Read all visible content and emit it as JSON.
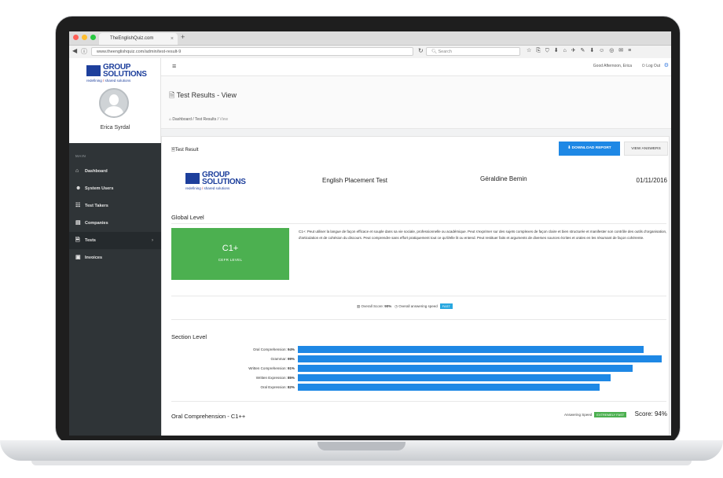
{
  "browser": {
    "tab_title": "TheEnglishQuiz.com",
    "url": "www.theenglishquiz.com/admin/test-result-9",
    "search_placeholder": "Search",
    "dot_colors": [
      "#ff5f57",
      "#ffbd2e",
      "#28c940"
    ]
  },
  "brand": {
    "name_line1": "GROUP",
    "name_line2": "SOLUTIONS",
    "tag_a": "redefining",
    "tag_sep": " / ",
    "tag_b": "shared solutions",
    "color": "#1d3f9c"
  },
  "sidebar": {
    "user_name": "Erica Syrdal",
    "menu_label": "MAIN",
    "items": [
      {
        "label": "Dashboard",
        "icon": "home-icon"
      },
      {
        "label": "System Users",
        "icon": "users-icon"
      },
      {
        "label": "Test Takers",
        "icon": "group-icon"
      },
      {
        "label": "Companies",
        "icon": "building-icon"
      },
      {
        "label": "Tests",
        "icon": "file-icon"
      },
      {
        "label": "Invoices",
        "icon": "invoice-icon"
      }
    ],
    "active_index": 4
  },
  "topbar": {
    "greeting": "Good Afternoon, Erica",
    "logout": "Log Out"
  },
  "page": {
    "title": "Test Results - View",
    "breadcrumb": [
      "Dashboard",
      "Test Results",
      "View"
    ]
  },
  "report": {
    "panel_title": "Test Result",
    "download_button": "DOWNLOAD REPORT",
    "view_answers_button": "VIEW ANSWERS",
    "test_name": "English Placement Test",
    "taker_name": "Géraldine Bemin",
    "date": "01/11/2016",
    "global_level_title": "Global Level",
    "level": "C1+",
    "level_sub": "CEFR LEVEL",
    "level_color": "#4cb050",
    "description": "C1+: Peut utiliser la langue de façon efficace et souple dans sa vie sociale, professionnelle ou académique. Peut s'exprimer sur des sujets complexes de façon claire et bien structurée et manifester son contrôle des outils d'organisation, d'articulation et de cohésion du discours. Peut comprendre sans effort pratiquement tout ce qu'il/elle lit ou entend. Peut restituer faits et arguments de diverses sources écrites et orales en les résumant de façon cohérente.",
    "overall_score_label": "Overall Score:",
    "overall_score_value": "90%",
    "overall_speed_label": "Overall answering speed",
    "overall_speed_value": "FAST",
    "section_level_title": "Section Level",
    "bar_color": "#1e88e5",
    "sections": [
      {
        "label": "Oral Comprehension:",
        "value_text": "94%",
        "value": 94
      },
      {
        "label": "Grammar:",
        "value_text": "99%",
        "value": 99
      },
      {
        "label": "Written Comprehension:",
        "value_text": "91%",
        "value": 91
      },
      {
        "label": "Written Expression:",
        "value_text": "85%",
        "value": 85
      },
      {
        "label": "Oral Expression:",
        "value_text": "82%",
        "value": 82
      }
    ],
    "oral_title": "Oral Comprehension - C1++",
    "answering_speed_label": "Answering Speed",
    "answering_speed_value": "EXTREMELY FAST",
    "oral_score": "Score: 94%"
  }
}
